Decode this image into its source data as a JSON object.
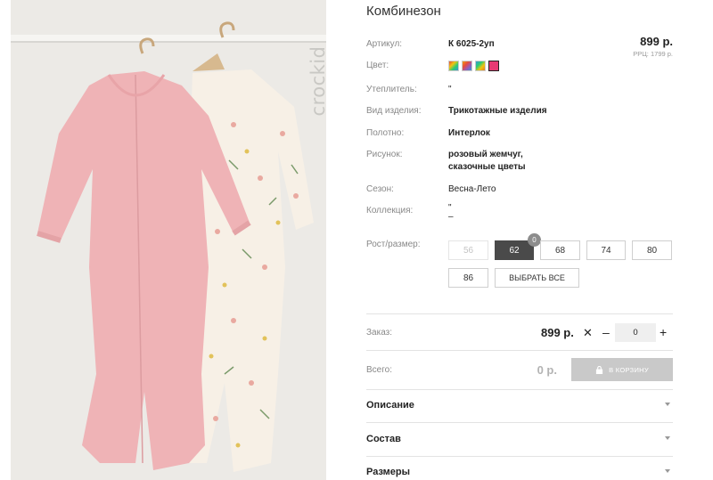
{
  "photo": {
    "brand_text": "crockid"
  },
  "product": {
    "title": "Комбинезон",
    "price": "899 р.",
    "rrp": "РРЦ: 1799 р."
  },
  "attributes": [
    {
      "label": "Артикул:",
      "value": "К 6025-2уп",
      "bold": true
    },
    {
      "label": "Цвет:",
      "value": "",
      "bold": false
    },
    {
      "label": "Утеплитель:",
      "value": "\"",
      "bold": false
    },
    {
      "label": "Вид изделия:",
      "value": "Трикотажные изделия",
      "bold": true
    },
    {
      "label": "Полотно:",
      "value": "Интерлок",
      "bold": true
    },
    {
      "label": "Рисунок:",
      "value": "розовый жемчуг,",
      "value2": "сказочные цветы",
      "bold": true
    },
    {
      "label": "Сезон:",
      "value": "Весна-Лето",
      "bold": false
    },
    {
      "label": "Коллекция:",
      "value": "\"",
      "value2": "–",
      "bold": false
    }
  ],
  "colors": [
    "multi",
    "multi",
    "multi",
    "#e63a73"
  ],
  "sizes": {
    "label": "Рост/размер:",
    "options": [
      {
        "label": "56",
        "state": "disabled"
      },
      {
        "label": "62",
        "state": "selected",
        "badge": "0"
      },
      {
        "label": "68",
        "state": "normal"
      },
      {
        "label": "74",
        "state": "normal"
      },
      {
        "label": "80",
        "state": "normal"
      },
      {
        "label": "86",
        "state": "normal"
      }
    ],
    "select_all": "ВЫБРАТЬ ВСЕ"
  },
  "order": {
    "label": "Заказ:",
    "price": "899 р.",
    "times": "✕",
    "minus": "–",
    "qty": "0",
    "plus": "+"
  },
  "total": {
    "label": "Всего:",
    "value": "0 р.",
    "cart_button": "В КОРЗИНУ"
  },
  "accordion": [
    "Описание",
    "Состав",
    "Размеры"
  ]
}
